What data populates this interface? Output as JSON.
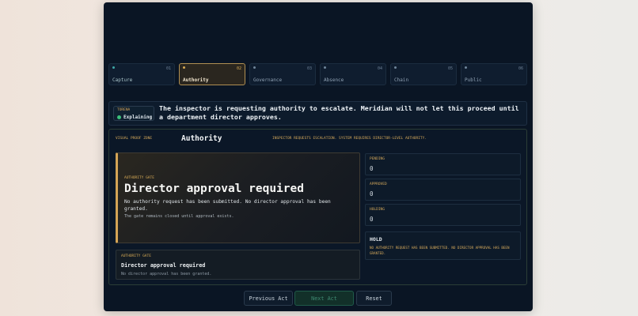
{
  "tabs": [
    {
      "label": "Capture",
      "num": "01",
      "active": false
    },
    {
      "label": "Authority",
      "num": "02",
      "active": true
    },
    {
      "label": "Governance",
      "num": "03",
      "active": false
    },
    {
      "label": "Absence",
      "num": "04",
      "active": false
    },
    {
      "label": "Chain",
      "num": "05",
      "active": false
    },
    {
      "label": "Public",
      "num": "06",
      "active": false
    }
  ],
  "banner": {
    "speaker": "TORENA",
    "state": "Explaining",
    "message": "The inspector is requesting authority to escalate. Meridian will not let this proceed until a department director approves."
  },
  "zone": {
    "tag": "VISUAL PROOF ZONE",
    "title": "Authority",
    "note": "INSPECTOR REQUESTS ESCALATION. SYSTEM REQUIRES DIRECTOR-LEVEL AUTHORITY."
  },
  "gate": {
    "tag": "AUTHORITY GATE",
    "title": "Director approval required",
    "desc": "No authority request has been submitted. No director approval has been granted.",
    "note": "The gate remains closed until approval exists."
  },
  "card": {
    "tag": "AUTHORITY GATE",
    "title": "Director approval required",
    "desc": "No director approval has been granted."
  },
  "stats": [
    {
      "label": "PENDING",
      "value": "0"
    },
    {
      "label": "APPROVED",
      "value": "0"
    },
    {
      "label": "HOLDING",
      "value": "0"
    }
  ],
  "hold": {
    "label": "HOLD",
    "desc": "NO AUTHORITY REQUEST HAS BEEN SUBMITTED. NO DIRECTOR APPROVAL HAS BEEN GRANTED."
  },
  "controls": {
    "prev": "Previous Act",
    "next": "Next Act",
    "reset": "Reset"
  },
  "colors": {
    "accent": "#d6aa55",
    "background": "#0a1524",
    "active_status": "#3bc07a"
  }
}
